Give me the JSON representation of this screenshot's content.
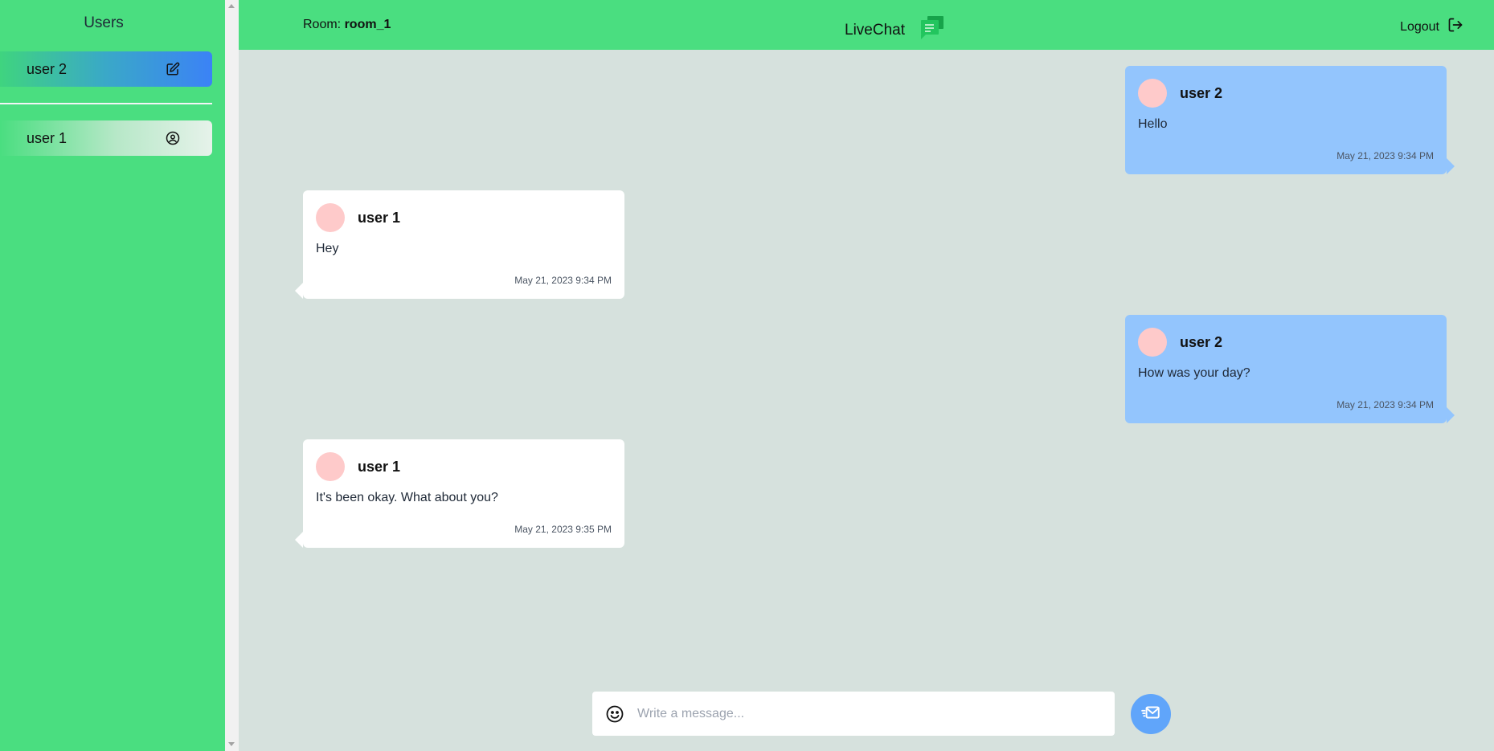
{
  "sidebar": {
    "title": "Users",
    "active_user": {
      "label": "user 2",
      "icon": "edit-icon"
    },
    "users": [
      {
        "label": "user 1",
        "icon": "user-circle-icon"
      }
    ]
  },
  "header": {
    "room_label": "Room:",
    "room_name": "room_1",
    "brand": "LiveChat",
    "brand_icon": "chat-bubbles-icon",
    "logout_label": "Logout",
    "logout_icon": "logout-icon"
  },
  "messages": [
    {
      "sender": "user 2",
      "text": "Hello",
      "time": "May 21, 2023 9:34 PM",
      "direction": "sent"
    },
    {
      "sender": "user 1",
      "text": "Hey",
      "time": "May 21, 2023 9:34 PM",
      "direction": "received"
    },
    {
      "sender": "user 2",
      "text": "How was your day?",
      "time": "May 21, 2023 9:34 PM",
      "direction": "sent"
    },
    {
      "sender": "user 1",
      "text": "It's been okay. What about you?",
      "time": "May 21, 2023 9:35 PM",
      "direction": "received"
    }
  ],
  "composer": {
    "placeholder": "Write a message...",
    "value": "",
    "emoji_icon": "emoji-icon",
    "send_icon": "send-mail-icon"
  },
  "colors": {
    "accent_green": "#4ade80",
    "sent_bubble": "#93c5fd",
    "received_bubble": "#ffffff",
    "chat_background": "#d6e1dd",
    "avatar": "#fecaca",
    "send_button": "#60a5fa"
  }
}
